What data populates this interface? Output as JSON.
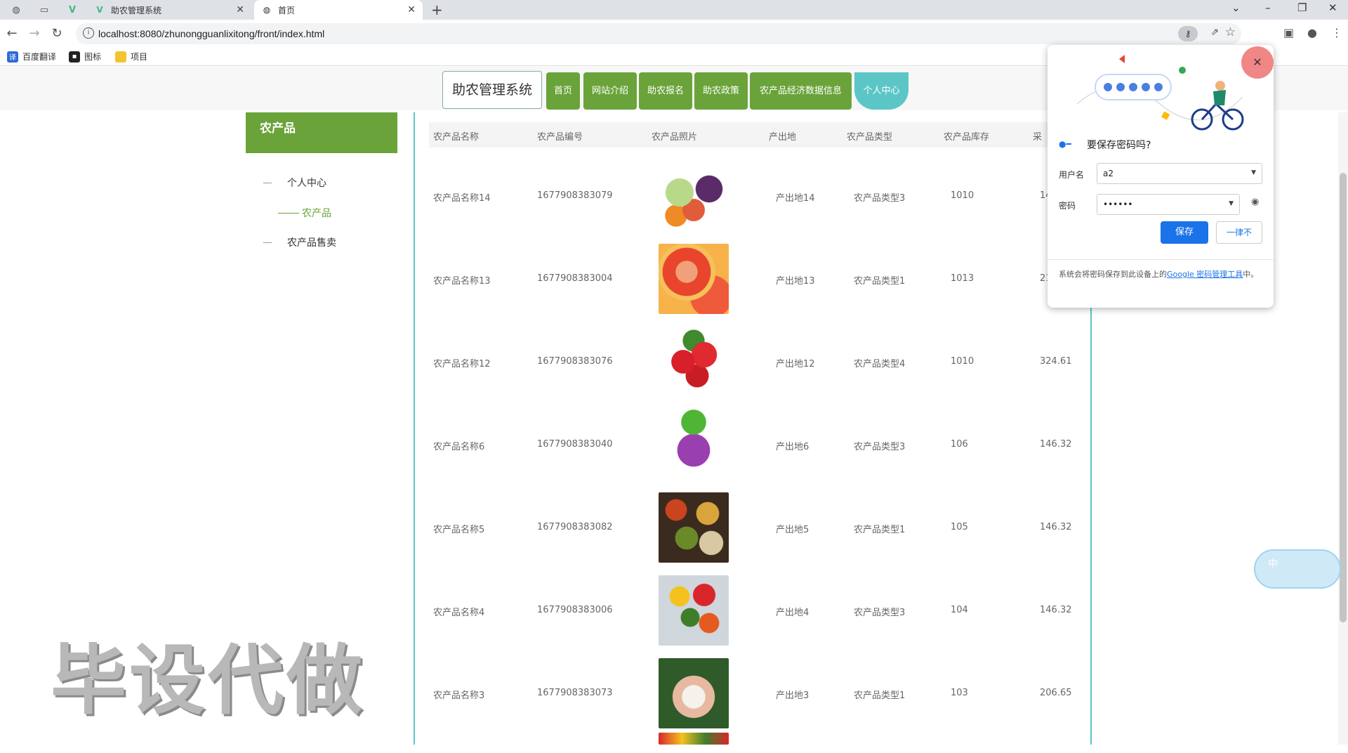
{
  "browser": {
    "tabs": [
      {
        "title": "助农管理系统",
        "active": false
      },
      {
        "title": "首页",
        "active": true
      }
    ],
    "url": "localhost:8080/zhunongguanlixitong/front/index.html",
    "bookmarks": [
      "百度翻译",
      "图标",
      "项目"
    ]
  },
  "nav": {
    "brand": "助农管理系统",
    "items": [
      "首页",
      "网站介绍",
      "助农报名",
      "助农政策",
      "农产品经济数据信息",
      "个人中心"
    ]
  },
  "sidebar": {
    "title": "农产品",
    "items": [
      {
        "label": "个人中心",
        "active": false
      },
      {
        "label": "农产品",
        "active": true
      },
      {
        "label": "农产品售卖",
        "active": false
      }
    ]
  },
  "table": {
    "headers": [
      "农产品名称",
      "农产品编号",
      "农产品照片",
      "产出地",
      "农产品类型",
      "农产品库存",
      "采"
    ],
    "rows": [
      {
        "name": "农产品名称14",
        "code": "1677908383079",
        "origin": "产出地14",
        "type": "农产品类型3",
        "stock": "1010",
        "price": "14"
      },
      {
        "name": "农产品名称13",
        "code": "1677908383004",
        "origin": "产出地13",
        "type": "农产品类型1",
        "stock": "1013",
        "price": "21"
      },
      {
        "name": "农产品名称12",
        "code": "1677908383076",
        "origin": "产出地12",
        "type": "农产品类型4",
        "stock": "1010",
        "price": "324.61"
      },
      {
        "name": "农产品名称6",
        "code": "1677908383040",
        "origin": "产出地6",
        "type": "农产品类型3",
        "stock": "106",
        "price": "146.32"
      },
      {
        "name": "农产品名称5",
        "code": "1677908383082",
        "origin": "产出地5",
        "type": "农产品类型1",
        "stock": "105",
        "price": "146.32"
      },
      {
        "name": "农产品名称4",
        "code": "1677908383006",
        "origin": "产出地4",
        "type": "农产品类型3",
        "stock": "104",
        "price": "146.32"
      },
      {
        "name": "农产品名称3",
        "code": "1677908383073",
        "origin": "产出地3",
        "type": "农产品类型1",
        "stock": "103",
        "price": "206.65"
      }
    ]
  },
  "watermark": "毕设代做",
  "password_popup": {
    "title": "要保存密码吗?",
    "username_label": "用户名",
    "username_value": "a2",
    "password_label": "密码",
    "password_value": "••••••",
    "save_label": "保存",
    "never_label": "一律不",
    "footer_text": "系统会将密码保存到此设备上的",
    "footer_link": "Google 密码管理工具",
    "footer_tail": "中。"
  },
  "float_widget": {
    "label": "中"
  },
  "colors": {
    "nav_green": "#6aa33a",
    "teal": "#5cc6c6",
    "google_blue": "#1a73e8"
  }
}
